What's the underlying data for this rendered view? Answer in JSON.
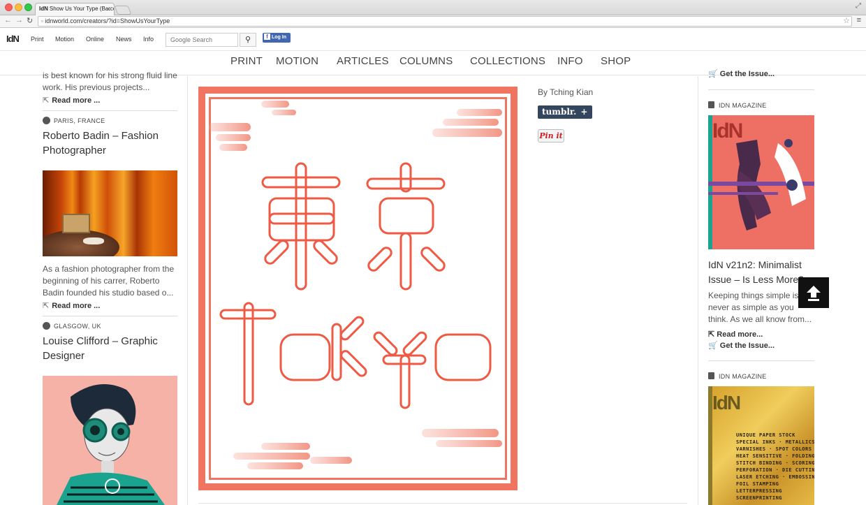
{
  "browser": {
    "tab_title": "Show Us Your Type (Barcel",
    "tab_favicon": "IdN",
    "url": "idnworld.com/creators/?id=ShowUsYourType"
  },
  "site": {
    "logo": "IdN",
    "top_links": [
      "Print",
      "Motion",
      "Online",
      "News",
      "Info"
    ],
    "search_placeholder": "Google Search",
    "fb_label": "Log In",
    "main_nav": [
      "PRINT",
      "MOTION",
      "ARTICLES",
      "COLUMNS",
      "COLLECTIONS",
      "INFO",
      "SHOP"
    ]
  },
  "left": {
    "top_excerpt": "is best known for his strong fluid line work. His previous projects...",
    "read_more": "Read more ...",
    "creators": [
      {
        "location": "PARIS, FRANCE",
        "title": "Roberto Badin – Fashion Photographer",
        "excerpt": "As a fashion photographer from the beginning of his carrer, Roberto Badin founded his studio based o..."
      },
      {
        "location": "GLASGOW, UK",
        "title": "Louise Clifford – Graphic Designer"
      }
    ]
  },
  "center": {
    "byline": "By Tching Kian",
    "tumblr_label": "tumblr.",
    "tumblr_plus": "+",
    "pinit_label": "Pin it",
    "poster_kanji": "東京",
    "poster_latin": "ToKyo",
    "accent_color": "#ef7561"
  },
  "right": {
    "top_get_issue": "Get the Issue...",
    "mag_label": "IDN MAGAZINE",
    "mag1_cover_logo": "IdN",
    "mag1_title": "IdN v21n2: Minimalist Issue – Is Less More?",
    "mag1_excerpt": "Keeping things simple is never as simple as you think. As we all know from...",
    "read_more": "Read more...",
    "get_issue": "Get the Issue...",
    "mag2_cover_logo": "IdN",
    "mag2_lines": [
      "UNIQUE PAPER STOCK",
      "SPECIAL INKS · METALLICS",
      "VARNISHES · SPOT COLORS",
      "HEAT SENSITIVE · FOLDING",
      "STITCH BINDING · SCORING",
      "PERFORATION · DIE CUTTING",
      "LASER ETCHING · EMBOSSING",
      "FOIL STAMPING",
      "LETTERPRESSING",
      "SCREENPRINTING"
    ]
  }
}
